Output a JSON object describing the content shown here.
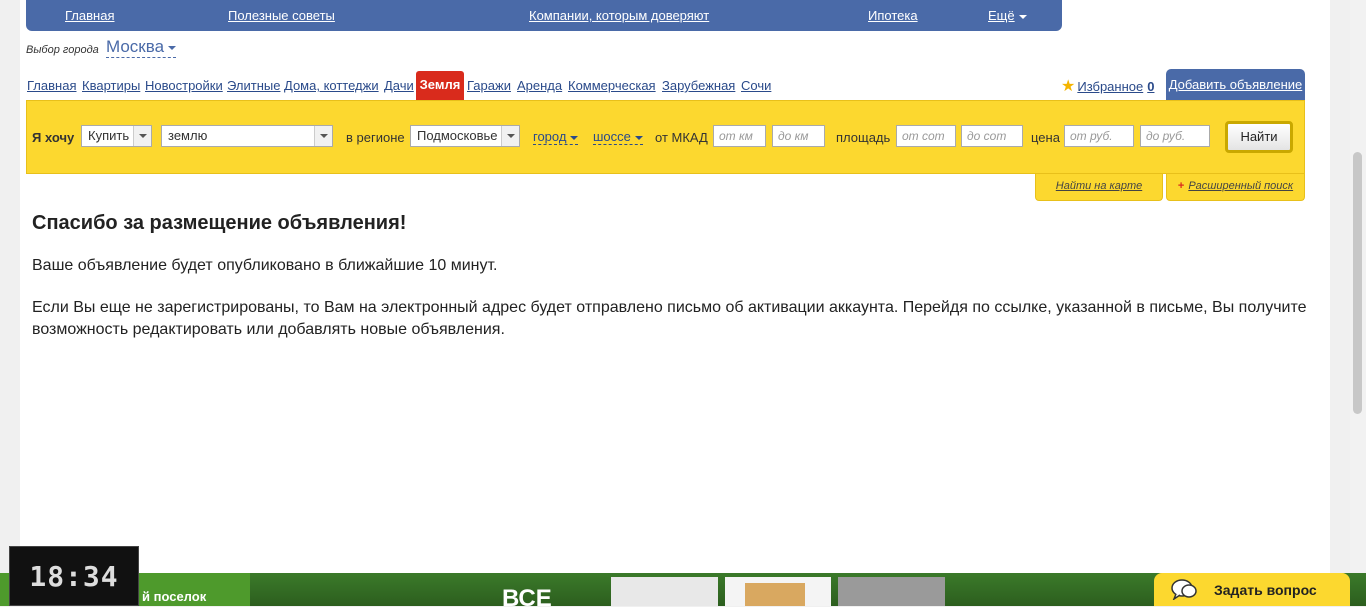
{
  "topnav": {
    "items": [
      "Главная",
      "Полезные советы",
      "Компании, которым доверяют",
      "Ипотека",
      "Ещё"
    ]
  },
  "city": {
    "label": "Выбор города",
    "value": "Москва"
  },
  "categories": {
    "items": [
      "Главная",
      "Квартиры",
      "Новостройки",
      "Элитные",
      "Дома, коттеджи",
      "Дачи",
      "Гаражи",
      "Аренда",
      "Коммерческая",
      "Зарубежная",
      "Сочи"
    ],
    "active": "Земля"
  },
  "favorites": {
    "label": "Избранное",
    "count": "0"
  },
  "add_ad": "Добавить объявление",
  "search": {
    "want_label": "Я хочу",
    "action_value": "Купить",
    "object_value": "землю",
    "region_label": "в регионе",
    "region_value": "Подмосковье",
    "city_link": "город",
    "highway_link": "шоссе",
    "mkad_label": "от МКАД",
    "mkad_from_placeholder": "от км",
    "mkad_to_placeholder": "до км",
    "area_label": "площадь",
    "area_from_placeholder": "от сот",
    "area_to_placeholder": "до сот",
    "price_label": "цена",
    "price_from_placeholder": "от руб.",
    "price_to_placeholder": "до руб.",
    "find_button": "Найти",
    "map_link": "Найти на карте",
    "advanced_link": "Расширенный поиск"
  },
  "content": {
    "title": "Спасибо за размещение объявления!",
    "paragraph1": "Ваше объявление будет опубликовано в ближайшие 10 минут.",
    "paragraph2": "Если Вы еще не зарегистрированы, то Вам на электронный адрес будет отправлено письмо об активации аккаунта. Перейдя по ссылке, указанной в письме, Вы получите возможность редактировать или добавлять новые объявления."
  },
  "banner": {
    "text": "й поселок",
    "big_text": "ВСЕ"
  },
  "clock": "18:34",
  "ask_button": "Задать вопрос",
  "colors": {
    "nav_blue": "#4a6aa8",
    "search_yellow": "#fcd82f",
    "active_red": "#d92b1c"
  }
}
